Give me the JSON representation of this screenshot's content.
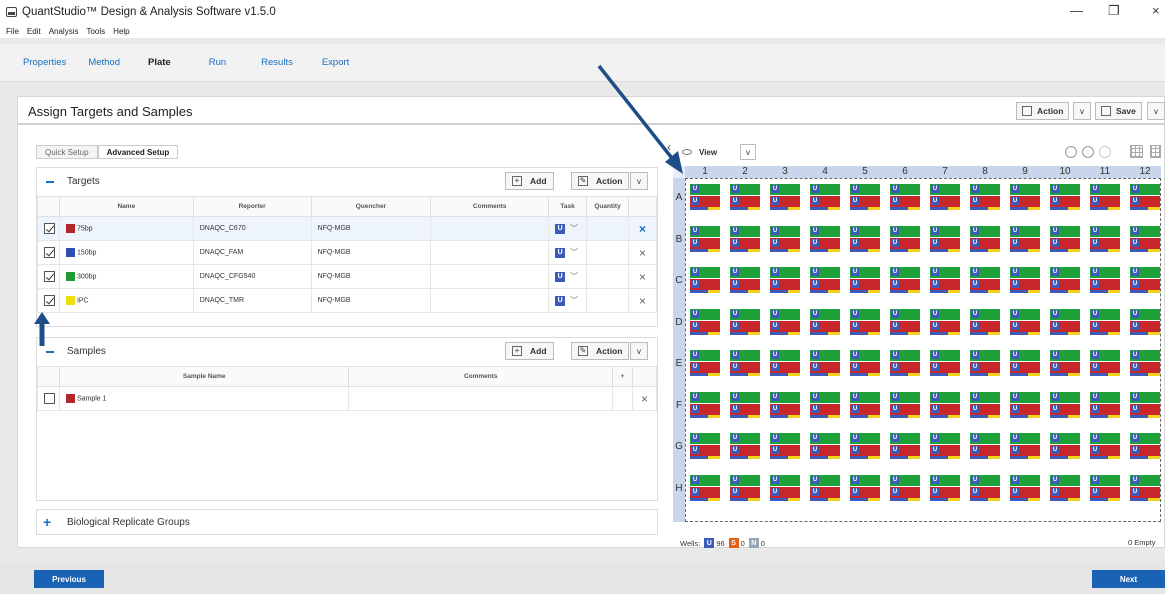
{
  "window": {
    "title": "QuantStudio™ Design & Analysis Software v1.5.0",
    "minimize": "—",
    "restore": "❐",
    "close": "×"
  },
  "menu": [
    "File",
    "Edit",
    "Analysis",
    "Tools",
    "Help"
  ],
  "tabs": [
    {
      "label": "Properties",
      "active": false
    },
    {
      "label": "Method",
      "active": false
    },
    {
      "label": "Plate",
      "active": true
    },
    {
      "label": "Run",
      "active": false
    },
    {
      "label": "Results",
      "active": false
    },
    {
      "label": "Export",
      "active": false
    }
  ],
  "page": {
    "title": "Assign Targets and Samples",
    "action_label": "Action",
    "save_label": "Save"
  },
  "setup_tabs": [
    {
      "label": "Quick Setup",
      "active": false
    },
    {
      "label": "Advanced Setup",
      "active": true
    }
  ],
  "targets": {
    "title": "Targets",
    "add_label": "Add",
    "action_label": "Action",
    "columns": [
      "Name",
      "Reporter",
      "Quencher",
      "Comments",
      "Task",
      "Quantity"
    ],
    "rows": [
      {
        "checked": true,
        "color": "#b3262b",
        "name": "75bp",
        "reporter": "DNAQC_C670",
        "quencher": "NFQ-MGB",
        "task": "U"
      },
      {
        "checked": true,
        "color": "#2d4fb0",
        "name": "150bp",
        "reporter": "DNAQC_FAM",
        "quencher": "NFQ-MGB",
        "task": "U"
      },
      {
        "checked": true,
        "color": "#1f9a35",
        "name": "300bp",
        "reporter": "DNAQC_CFG540",
        "quencher": "NFQ-MGB",
        "task": "U"
      },
      {
        "checked": true,
        "color": "#f0df10",
        "name": "IPC",
        "reporter": "DNAQC_TMR",
        "quencher": "NFQ-MGB",
        "task": "U"
      }
    ]
  },
  "samples": {
    "title": "Samples",
    "add_label": "Add",
    "action_label": "Action",
    "columns": [
      "Sample Name",
      "Comments",
      "+"
    ],
    "rows": [
      {
        "checked": false,
        "color": "#b3262b",
        "name": "Sample 1"
      }
    ]
  },
  "bio_groups": {
    "title": "Biological Replicate Groups",
    "expand": "+"
  },
  "plate": {
    "view_label": "View",
    "columns": [
      "1",
      "2",
      "3",
      "4",
      "5",
      "6",
      "7",
      "8",
      "9",
      "10",
      "11",
      "12"
    ],
    "rows": [
      "A",
      "B",
      "C",
      "D",
      "E",
      "F",
      "G",
      "H"
    ],
    "well_badge": "U",
    "colors": {
      "green": "#1fa13a",
      "red": "#c8262b",
      "blue": "#3c5bb8",
      "yellow": "#f3d21b"
    }
  },
  "wells_summary": {
    "label": "Wells:",
    "unknown_badge": "U",
    "unknown_count": "96",
    "standard_badge": "S",
    "standard_count": "0",
    "ntc_badge": "N",
    "ntc_count": "0",
    "empty_text": "0 Empty"
  },
  "footer": {
    "previous_label": "Previous",
    "next_label": "Next"
  },
  "glyphs": {
    "caret": "v",
    "remove": "×",
    "edit": "✎",
    "add": "+"
  }
}
